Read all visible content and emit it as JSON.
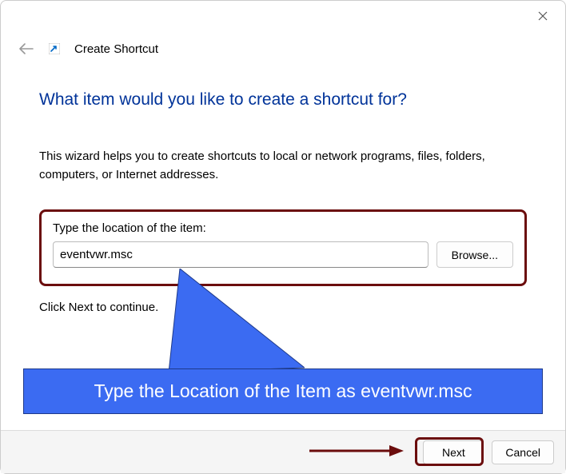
{
  "titlebar": {
    "close_icon": "✕"
  },
  "header": {
    "back_icon": "←",
    "title": "Create Shortcut"
  },
  "content": {
    "heading": "What item would you like to create a shortcut for?",
    "description": "This wizard helps you to create shortcuts to local or network programs, files, folders, computers, or Internet addresses.",
    "input_label": "Type the location of the item:",
    "input_value": "eventvwr.msc",
    "browse_label": "Browse...",
    "continue_text": "Click Next to continue."
  },
  "annotation": {
    "banner_text": "Type the Location of the Item as eventvwr.msc",
    "highlight_colors": {
      "box": "#6b0d0d",
      "banner_bg": "#3b6bf2"
    }
  },
  "footer": {
    "next_label": "Next",
    "cancel_label": "Cancel"
  }
}
